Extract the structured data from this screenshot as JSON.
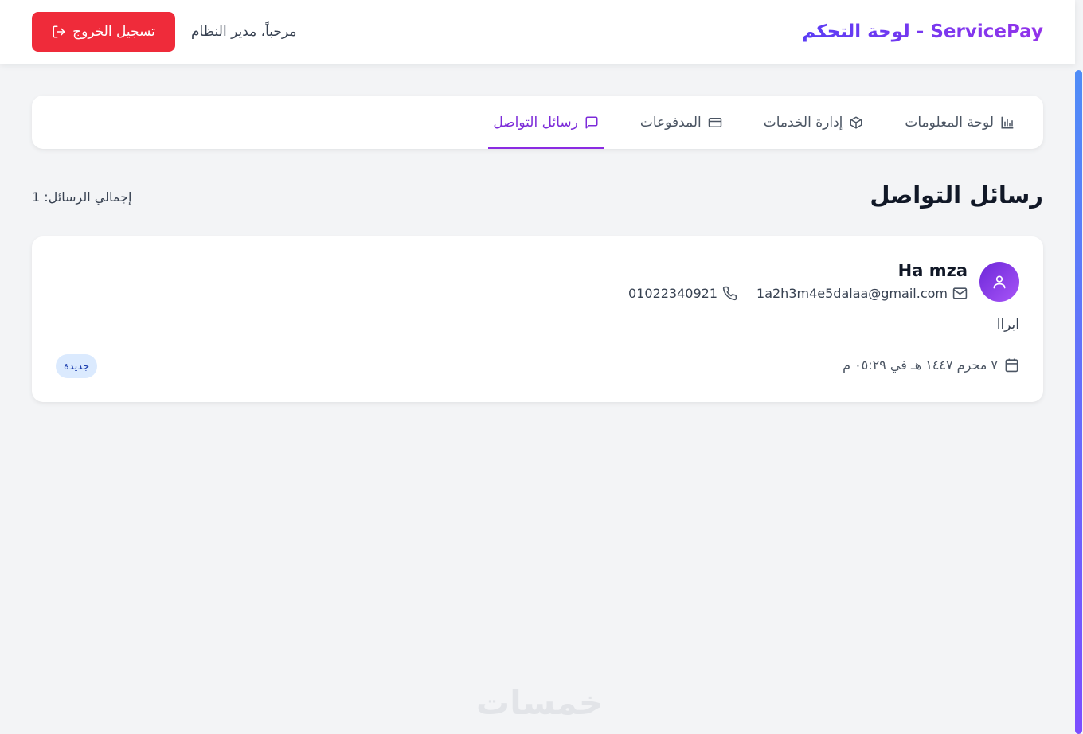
{
  "header": {
    "brand": "ServicePay - لوحة التحكم",
    "welcome": "مرحباً، مدير النظام",
    "logout_label": "تسجيل الخروج"
  },
  "tabs": [
    {
      "label": "لوحة المعلومات",
      "icon": "bar-chart-icon",
      "active": false
    },
    {
      "label": "إدارة الخدمات",
      "icon": "package-icon",
      "active": false
    },
    {
      "label": "المدفوعات",
      "icon": "credit-card-icon",
      "active": false
    },
    {
      "label": "رسائل التواصل",
      "icon": "message-square-icon",
      "active": true
    }
  ],
  "section": {
    "title": "رسائل التواصل",
    "total_label": "إجمالي الرسائل: 1"
  },
  "messages": [
    {
      "name": "Ha mza",
      "email": "1a2h3m4e5dalaa@gmail.com",
      "phone": "01022340921",
      "body": "ابراا",
      "date": "٧ محرم ١٤٤٧ هـ في ٠٥:٢٩ م",
      "status": "جديدة"
    }
  ],
  "watermark": "خمسات",
  "colors": {
    "accent": "#7c2bd9",
    "logout": "#ef2b3a",
    "badge_bg": "#dbeafe",
    "badge_text": "#1e40af"
  }
}
